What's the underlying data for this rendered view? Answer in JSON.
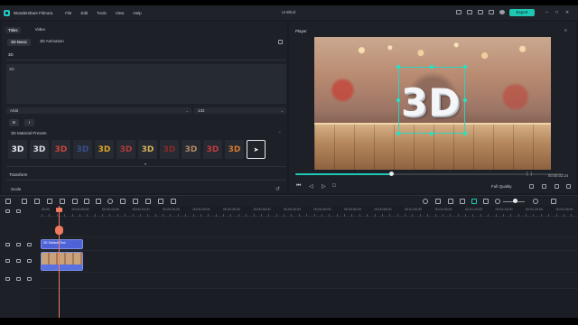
{
  "app": {
    "name": "Wondershare Filmora",
    "menu": [
      "File",
      "Edit",
      "Tools",
      "View",
      "Help"
    ],
    "document_title": "Untitled",
    "export_label": "Export",
    "accent_color": "#1ec8b4",
    "window_controls": [
      "–",
      "□",
      "✕"
    ]
  },
  "titles_panel": {
    "tabs": [
      "Titles",
      "Video"
    ],
    "active_tab": "Titles",
    "subtabs": [
      "3D Basic",
      "3D Animation"
    ],
    "active_subtab": "3D Basic",
    "section_3d": "3D",
    "text_value": "3D",
    "font": "Arial",
    "font_size": "132",
    "bold_label": "B",
    "italic_label": "I",
    "material_presets_label": "3D Material Presets",
    "presets": [
      {
        "label": "3D",
        "color": "#e8ecef"
      },
      {
        "label": "3D",
        "color": "#d9dde2"
      },
      {
        "label": "3D",
        "color": "#c9453a"
      },
      {
        "label": "3D",
        "color": "#3b4e8c"
      },
      {
        "label": "3D",
        "color": "#e0a526"
      },
      {
        "label": "3D",
        "color": "#b43a3a"
      },
      {
        "label": "3D",
        "color": "#d6b35a"
      },
      {
        "label": "3D",
        "color": "#8c2a2a"
      },
      {
        "label": "3D",
        "color": "#b48a66"
      },
      {
        "label": "3D",
        "color": "#c43c3c"
      },
      {
        "label": "3D",
        "color": "#d87a2e"
      }
    ],
    "transform_label": "Transform",
    "scale_label": "Scale",
    "ok_label": "OK",
    "advanced_label": "Advanced"
  },
  "player": {
    "title": "Player",
    "canvas_text": "3D",
    "progress_fraction": 0.36,
    "timecode": "00:00:02:24",
    "quality": "Full Quality"
  },
  "timeline": {
    "ruler_labels": [
      "00:00",
      "00:00:05:00",
      "00:00:10:00",
      "00:00:15:00",
      "00:00:20:00",
      "00:00:25:00",
      "00:00:30:00",
      "00:00:35:00",
      "00:00:40:00",
      "00:00:45:00",
      "00:00:50:00",
      "00:00:55:00",
      "00:01:00:00",
      "00:01:05:00",
      "00:01:10:00",
      "00:01:15:00",
      "00:01:20:00",
      "00:01:25:00"
    ],
    "title_clip_label": "3D Default Text",
    "playhead_color": "#f07a5f"
  }
}
